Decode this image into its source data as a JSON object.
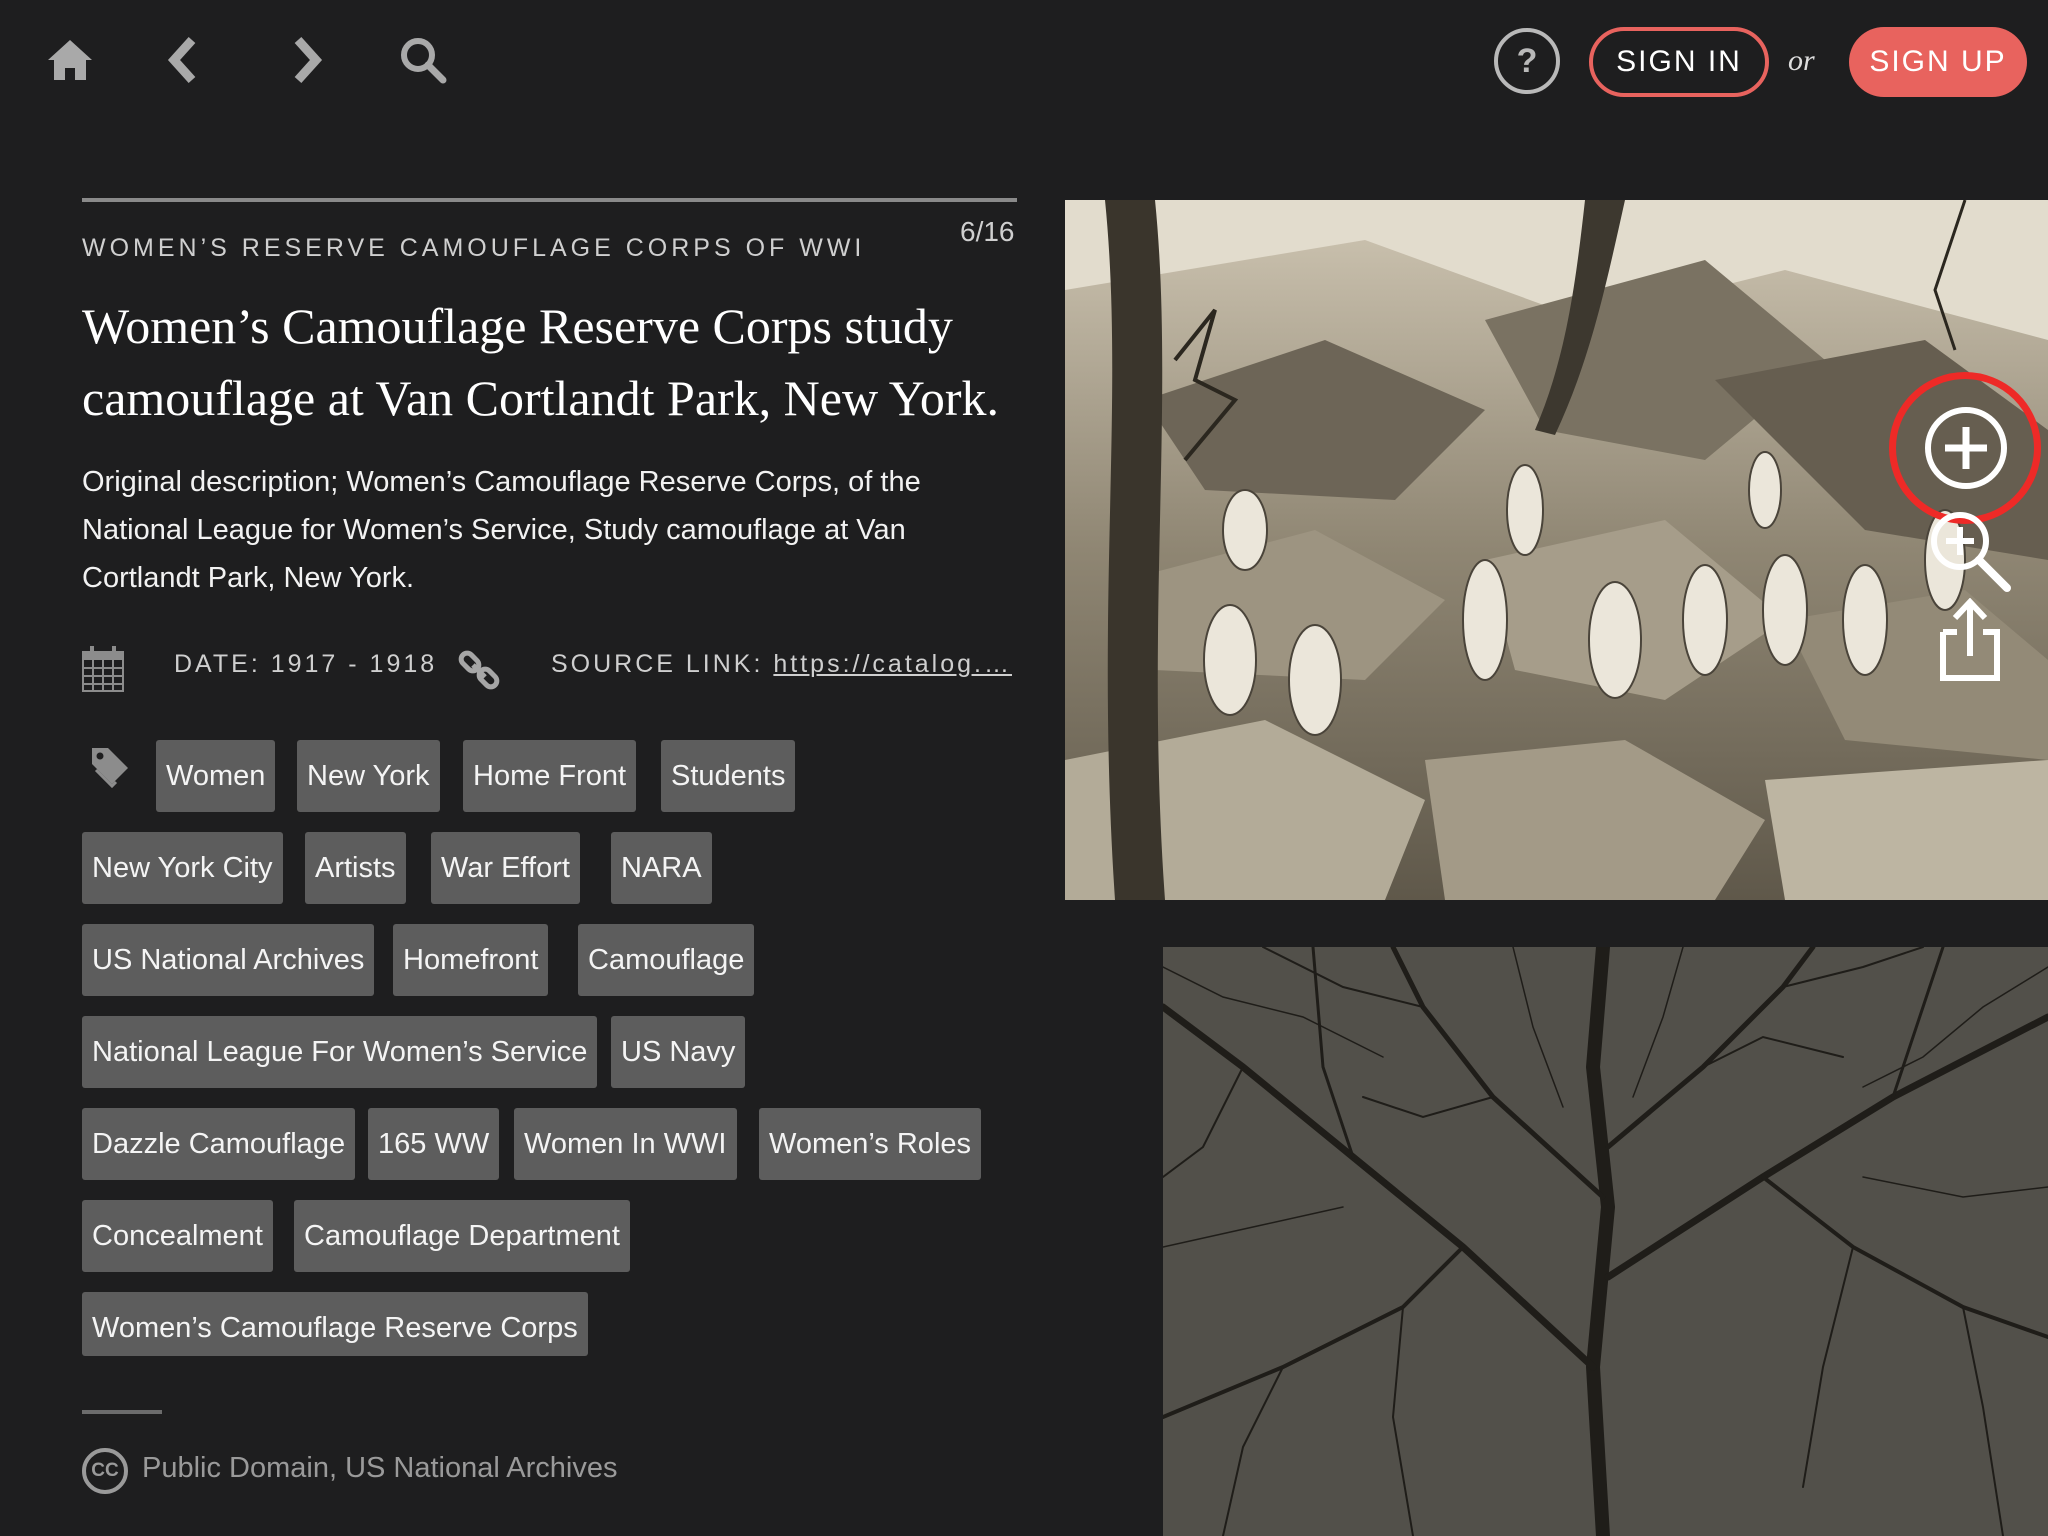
{
  "nav": {
    "icons": [
      "home-icon",
      "chevron-left-icon",
      "chevron-right-icon",
      "search-icon"
    ],
    "help_label": "?",
    "signin_label": "SIGN IN",
    "or_label": "or",
    "signup_label": "SIGN UP",
    "accent_color": "#e8635e"
  },
  "item": {
    "counter": "6/16",
    "collection": "WOMEN’S RESERVE CAMOUFLAGE CORPS OF WWI",
    "title": "Women’s Camouflage Reserve Corps study camouflage at Van Cortlandt Park, New York.",
    "description": "Original description; Women’s Camouflage Reserve Corps, of the National League for Women’s Service, Study camouflage at Van Cortlandt Park, New York.",
    "date_text": "DATE: 1917 - 1918",
    "source_label": "SOURCE LINK: ",
    "source_link": "https://catalog.…",
    "tags": [
      "Women",
      "New York",
      "Home Front",
      "Students",
      "New York City",
      "Artists",
      "War Effort",
      "NARA",
      "US National Archives",
      "Homefront",
      "Camouflage",
      "National League For Women’s Service",
      "US Navy",
      "Dazzle Camouflage",
      "165 WW",
      "Women In WWI",
      "Women’s Roles",
      "Concealment",
      "Camouflage Department",
      "Women’s Camouflage Reserve Corps"
    ],
    "license_icon": "CC",
    "license": "Public Domain, US National Archives"
  },
  "media": {
    "tools": [
      "add-circle-icon",
      "zoom-in-icon",
      "share-icon"
    ],
    "highlight_color": "#ee2a27"
  }
}
